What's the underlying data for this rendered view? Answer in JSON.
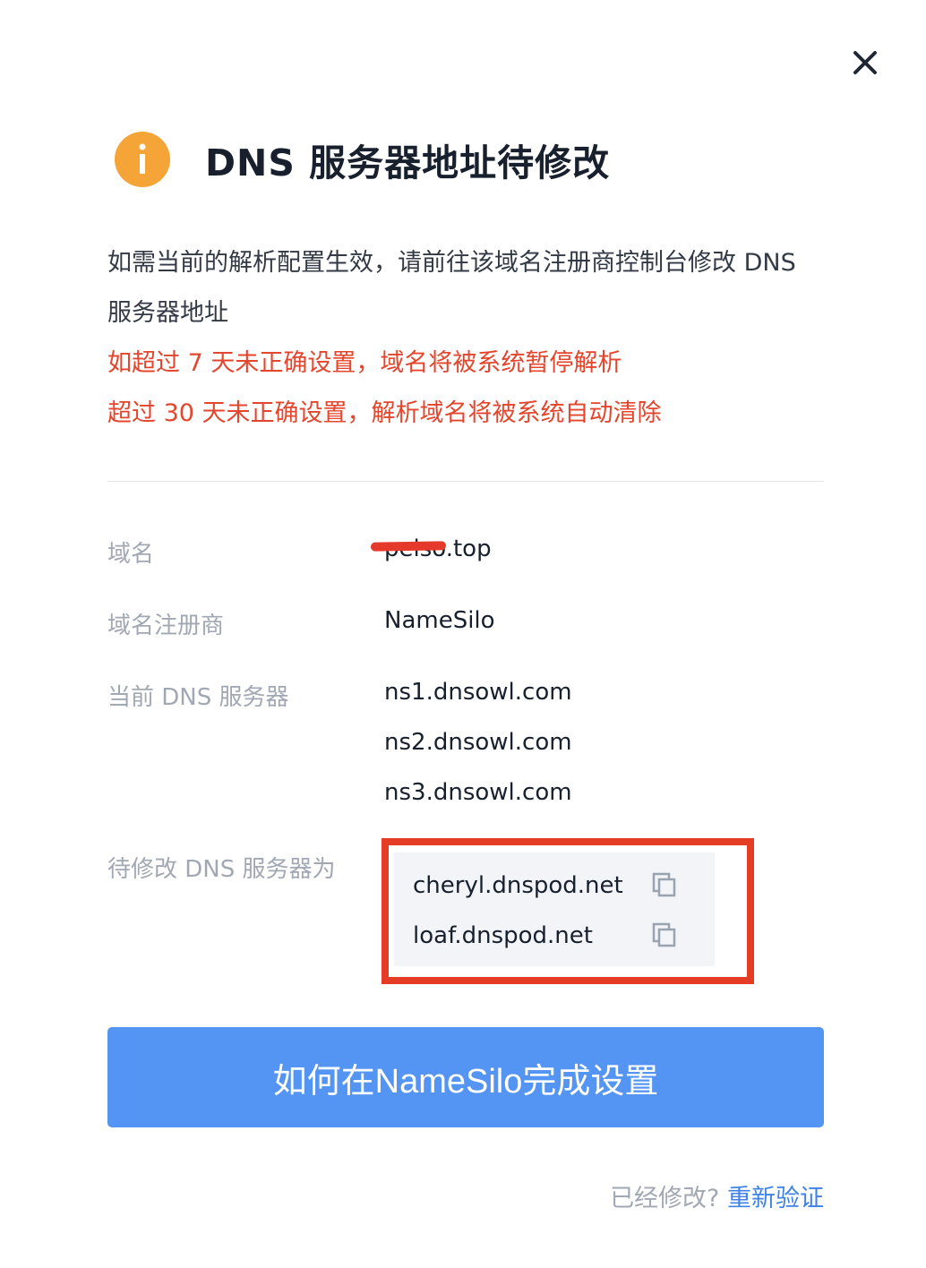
{
  "dialog": {
    "close_icon": "close-icon",
    "info_icon": "info-icon",
    "info_icon_color": "#f5a437",
    "title": "DNS 服务器地址待修改",
    "description_line1": "如需当前的解析配置生效，请前往该域名注册商控制台修改 DNS",
    "description_line2": "服务器地址",
    "warning_line1": "如超过 7 天未正确设置，域名将被系统暂停解析",
    "warning_line2": "超过 30 天未正确设置，解析域名将被系统自动清除",
    "warning_color": "#e4452d"
  },
  "details": {
    "domain_label": "域名",
    "domain_value": "pelso.top",
    "registrar_label": "域名注册商",
    "registrar_value": "NameSilo",
    "current_dns_label": "当前 DNS 服务器",
    "current_dns": [
      "ns1.dnsowl.com",
      "ns2.dnsowl.com",
      "ns3.dnsowl.com"
    ],
    "target_dns_label": "待修改 DNS 服务器为",
    "target_dns": [
      "cheryl.dnspod.net",
      "loaf.dnspod.net"
    ],
    "copy_icon": "copy-icon"
  },
  "actions": {
    "primary_button": "如何在NameSilo完成设置",
    "primary_color": "#5494f2",
    "footer_question": "已经修改?",
    "footer_link": "重新验证",
    "link_color": "#3e82e6"
  }
}
